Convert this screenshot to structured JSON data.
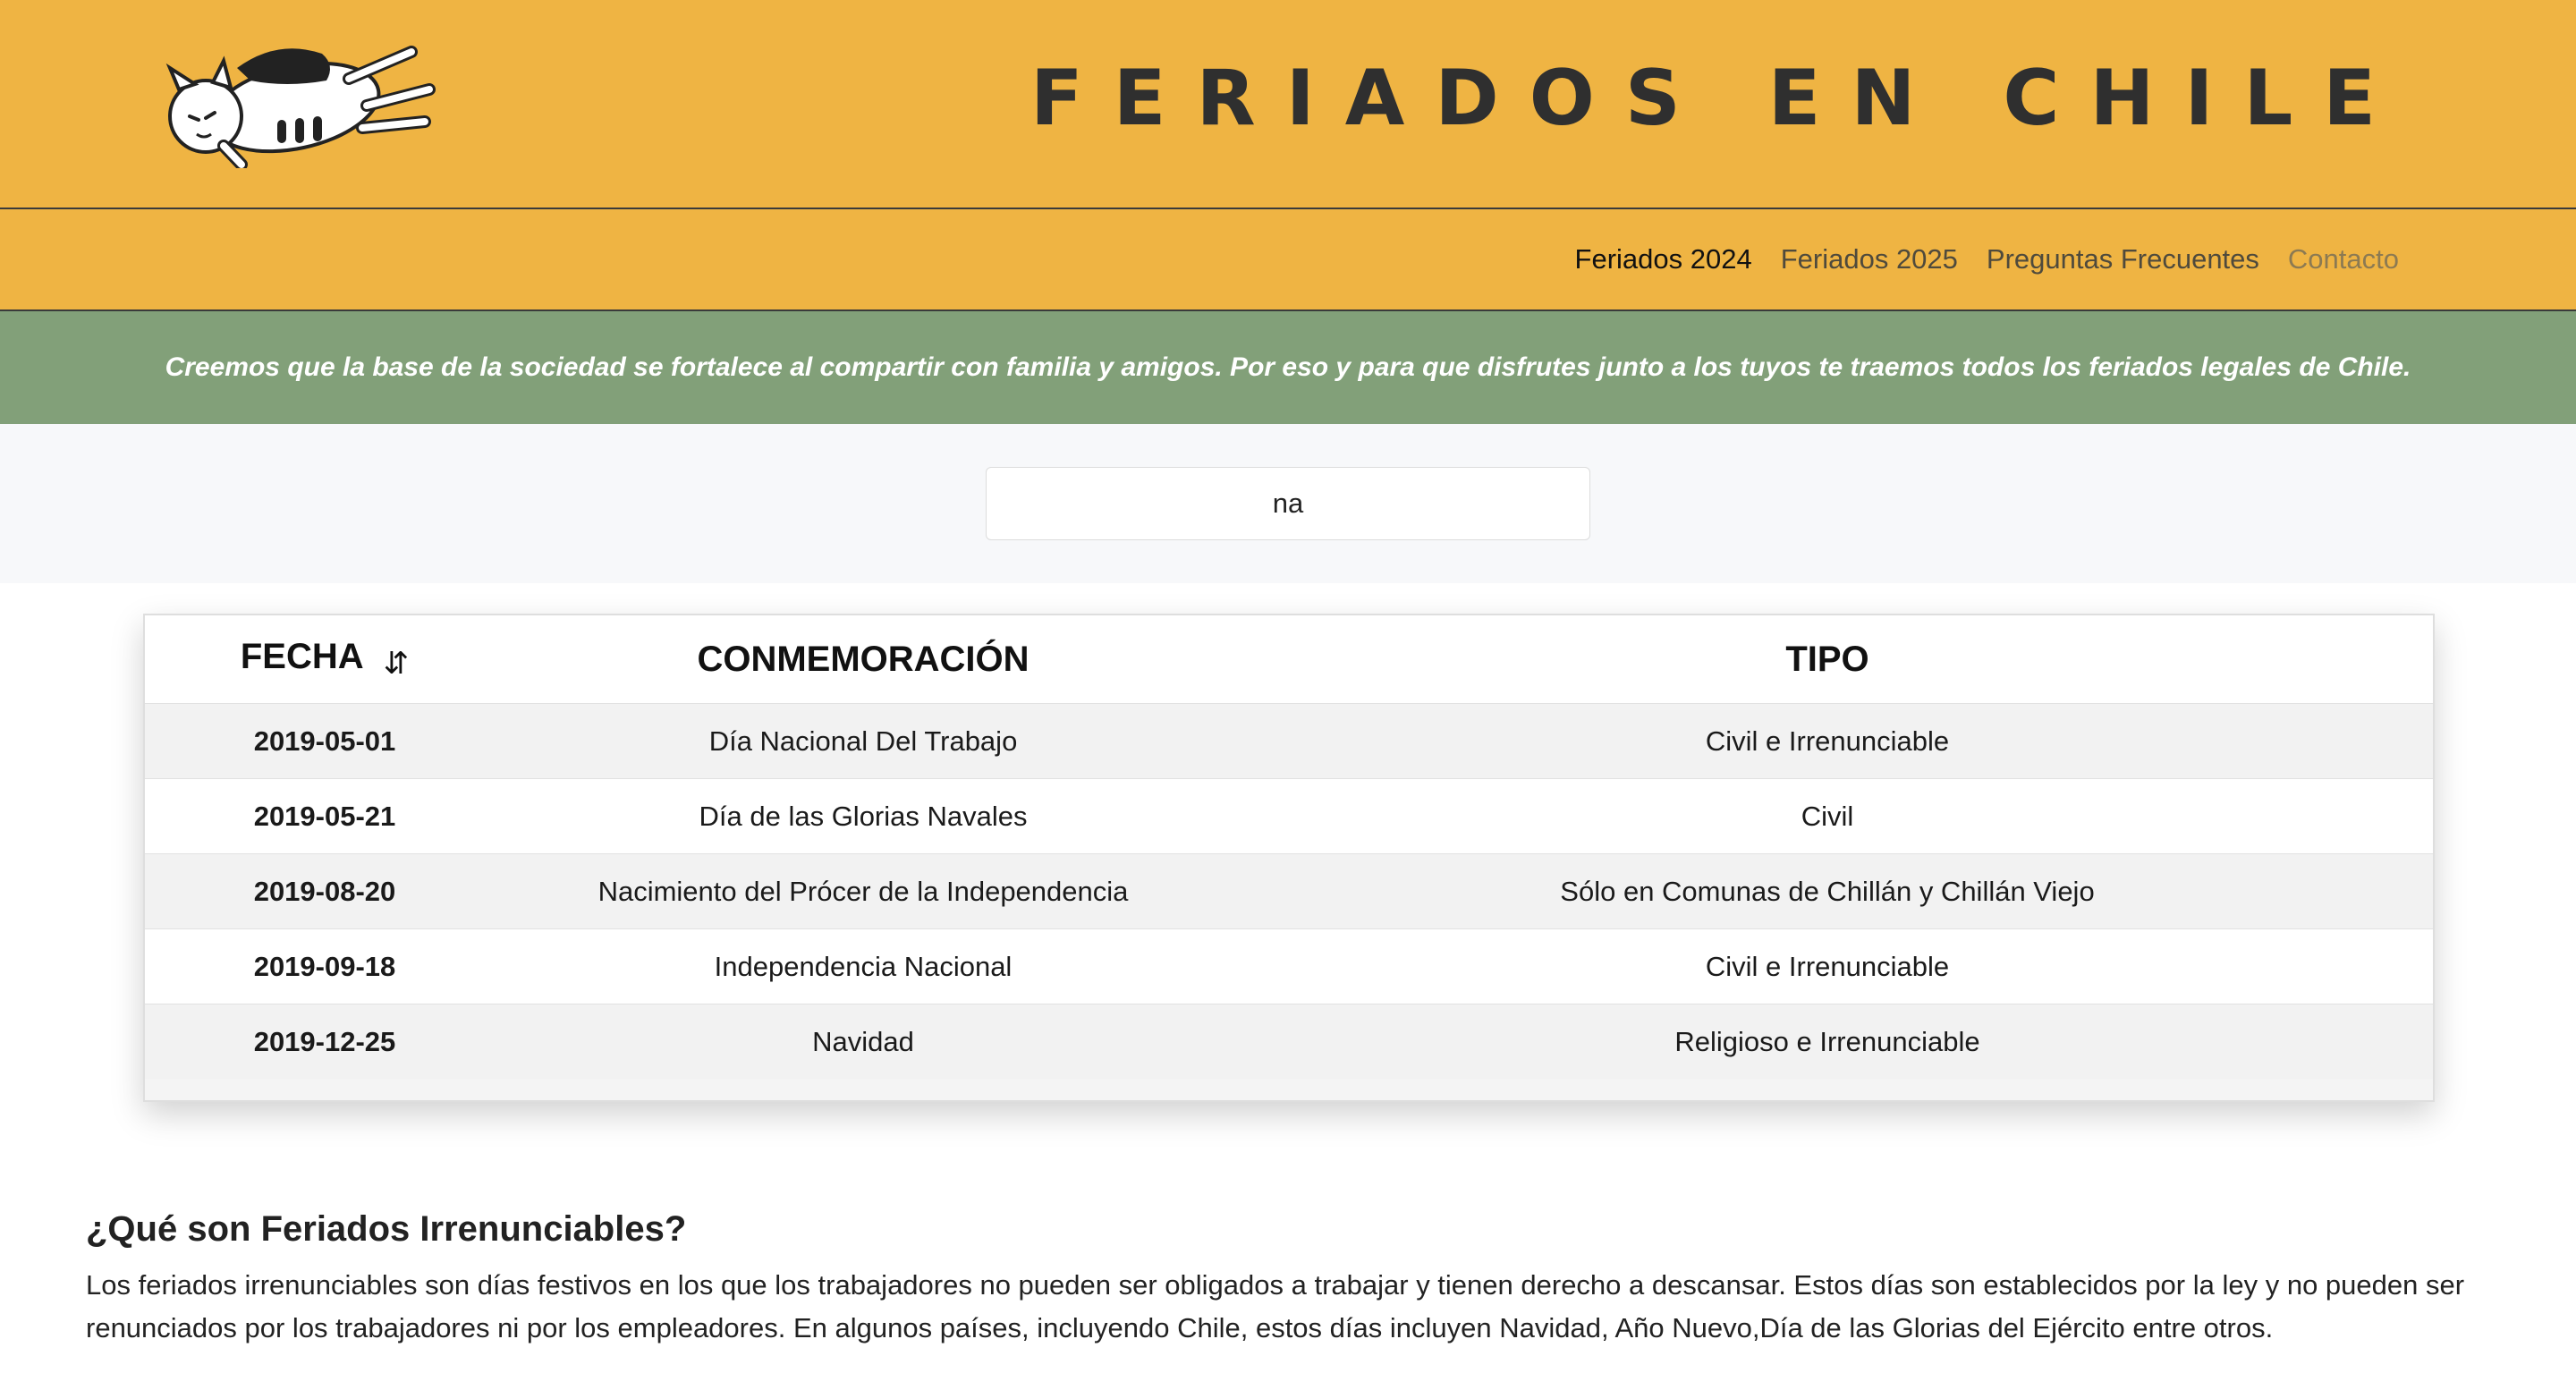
{
  "header": {
    "title": "FERIADOS EN CHILE",
    "logo_icon": "sleeping-cat-logo"
  },
  "nav": {
    "items": [
      {
        "label": "Feriados 2024"
      },
      {
        "label": "Feriados 2025"
      },
      {
        "label": "Preguntas Frecuentes"
      },
      {
        "label": "Contacto"
      }
    ]
  },
  "banner": {
    "text": "Creemos que la base de la sociedad se fortalece al compartir con familia y amigos. Por eso y para que disfrutes junto a los tuyos te traemos todos los feriados legales de Chile."
  },
  "search": {
    "value": "na"
  },
  "table": {
    "headers": {
      "fecha": "FECHA",
      "conmemoracion": "CONMEMORACIÓN",
      "tipo": "TIPO"
    },
    "sort_icon": "⇵",
    "rows": [
      {
        "fecha": "2019-05-01",
        "conmemoracion": "Día Nacional Del Trabajo",
        "tipo": "Civil e Irrenunciable"
      },
      {
        "fecha": "2019-05-21",
        "conmemoracion": "Día de las Glorias Navales",
        "tipo": "Civil"
      },
      {
        "fecha": "2019-08-20",
        "conmemoracion": "Nacimiento del Prócer de la Independencia",
        "tipo": "Sólo en Comunas de Chillán y Chillán Viejo"
      },
      {
        "fecha": "2019-09-18",
        "conmemoracion": "Independencia Nacional",
        "tipo": "Civil e Irrenunciable"
      },
      {
        "fecha": "2019-12-25",
        "conmemoracion": "Navidad",
        "tipo": "Religioso e Irrenunciable"
      }
    ]
  },
  "faq": {
    "title": "¿Qué son Feriados Irrenunciables?",
    "body": "Los feriados irrenunciables son días festivos en los que los trabajadores no pueden ser obligados a trabajar y tienen derecho a descansar. Estos días son establecidos por la ley y no pueden ser renunciados por los trabajadores ni por los empleadores. En algunos países, incluyendo Chile, estos días incluyen Navidad, Año Nuevo,Día de las Glorias del Ejército entre otros."
  },
  "colors": {
    "header_bg": "#EFB443",
    "banner_bg": "#82A079",
    "search_band_bg": "#F7F8FA",
    "row_alt_bg": "#F2F2F2"
  }
}
